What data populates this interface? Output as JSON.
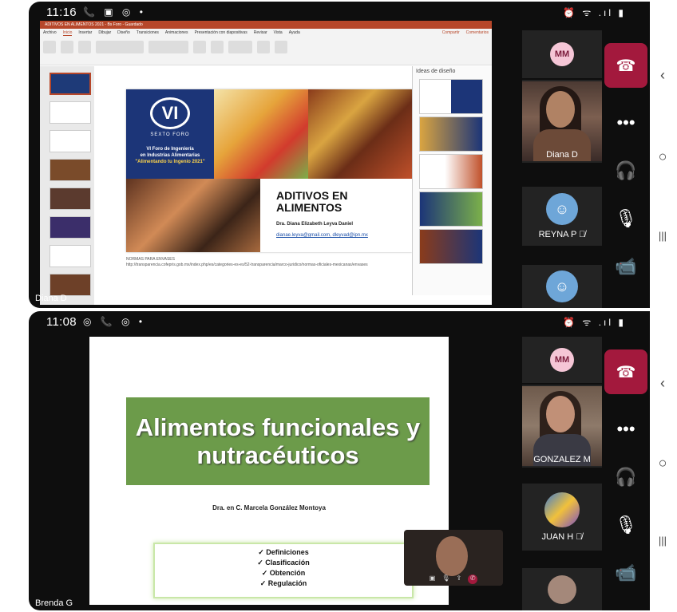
{
  "top": {
    "status_time": "11:16",
    "status_right": "⏰ ᯤ .ıl ▮",
    "corner_name": "Diana D",
    "ppt": {
      "title_bar": "ADITIVOS EN ALIMENTOS 2021 - Bs Foro - Guardado",
      "tabs": [
        "Archivo",
        "Inicio",
        "Insertar",
        "Dibujar",
        "Diseño",
        "Transiciones",
        "Animaciones",
        "Presentación con diapositivas",
        "Revisar",
        "Vista",
        "Ayuda"
      ],
      "share_label": "Compartir",
      "comments_label": "Comentarios",
      "ideas_title": "Ideas de diseño",
      "notes_line1": "NORMAS PARA ENVASES",
      "notes_line2": "http://transparencia.cofepris.gob.mx/index.php/es/categories-es-es/52-transparencia/marco-juridico/normas-oficiales-mexicanas/envases"
    },
    "slide": {
      "logo": "VI",
      "logo_sub": "SEXTO FORO",
      "forum_line1": "VI Foro de Ingeniería",
      "forum_line2": "en Industrias Alimentarias",
      "forum_line3": "\"Alimentando tu Ingenio 2021\"",
      "title": "ADITIVOS EN ALIMENTOS",
      "author": "Dra. Diana Elizabeth Leyva Daniel",
      "emails": "dianae.leyva@gmail.com, dleyvad@ipn.mx"
    },
    "participants": [
      {
        "initials": "MM"
      },
      {
        "name": "Diana D"
      },
      {
        "name": "REYNA P",
        "muted": "🎙̸"
      }
    ]
  },
  "bottom": {
    "status_time": "11:08",
    "status_right": "⏰ ᯤ .ıl ▮",
    "corner_name": "Brenda G",
    "slide": {
      "title": "Alimentos funcionales y nutracéuticos",
      "author": "Dra. en C. Marcela González Montoya",
      "items": [
        "✓ Definiciones",
        "✓ Clasificación",
        "✓ Obtención",
        "✓ Regulación"
      ]
    },
    "participants": [
      {
        "initials": "MM"
      },
      {
        "name": "GONZALEZ M"
      },
      {
        "name": "JUAN H",
        "muted": "🎙̸"
      }
    ]
  },
  "controls": {
    "hangup": "☎",
    "more": "•••",
    "audio": "🎧",
    "mic": "🎙",
    "camera": "📹"
  },
  "nav": {
    "back": "‹",
    "home": "○",
    "recents": "|||"
  }
}
